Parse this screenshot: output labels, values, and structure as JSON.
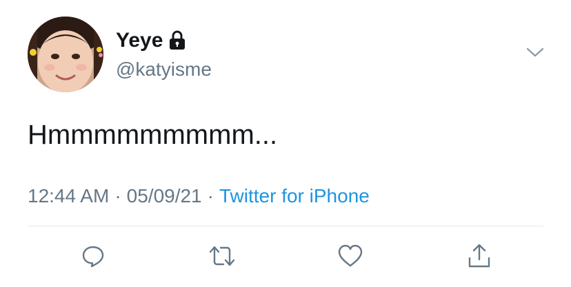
{
  "user": {
    "display_name": "Yeye",
    "handle": "@katyisme",
    "protected_icon": "lock-icon",
    "avatar": "profile-photo"
  },
  "tweet": {
    "text": "Hmmmmmmmmm...",
    "time": "12:44 AM",
    "separator": "·",
    "date": "05/09/21",
    "source": "Twitter for iPhone"
  },
  "actions": [
    {
      "name": "reply",
      "icon": "comment-icon"
    },
    {
      "name": "retweet",
      "icon": "retweet-icon"
    },
    {
      "name": "like",
      "icon": "heart-icon"
    },
    {
      "name": "share",
      "icon": "share-icon"
    }
  ],
  "colors": {
    "text": "#14171a",
    "secondary": "#657786",
    "link": "#1b95e0",
    "divider": "#e1e8ed"
  }
}
